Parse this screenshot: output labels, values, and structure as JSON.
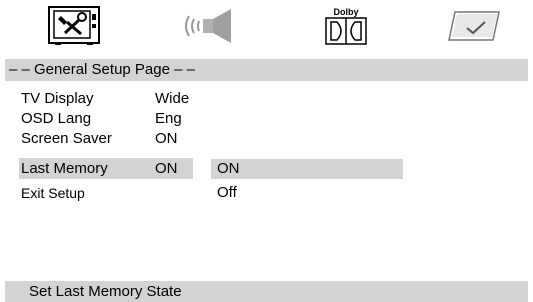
{
  "tabs": [
    {
      "id": "general",
      "icon": "tv-wrench-icon"
    },
    {
      "id": "audio",
      "icon": "speaker-icon"
    },
    {
      "id": "dolby",
      "icon": "dolby-icon",
      "label": "Dolby"
    },
    {
      "id": "preference",
      "icon": "checkmark-icon"
    }
  ],
  "page_title": "– – General Setup Page – –",
  "menu": [
    {
      "label": "TV Display",
      "value": "Wide"
    },
    {
      "label": "OSD Lang",
      "value": "Eng"
    },
    {
      "label": "Screen Saver",
      "value": "ON"
    },
    {
      "label": "Last Memory",
      "value": "ON"
    },
    {
      "label": "Exit Setup",
      "value": ""
    }
  ],
  "submenu": {
    "options": [
      "ON",
      "Off"
    ],
    "selected": "ON"
  },
  "status": "Set Last Memory State",
  "colors": {
    "highlight": "#d3d3d3",
    "background": "#ffffff"
  }
}
